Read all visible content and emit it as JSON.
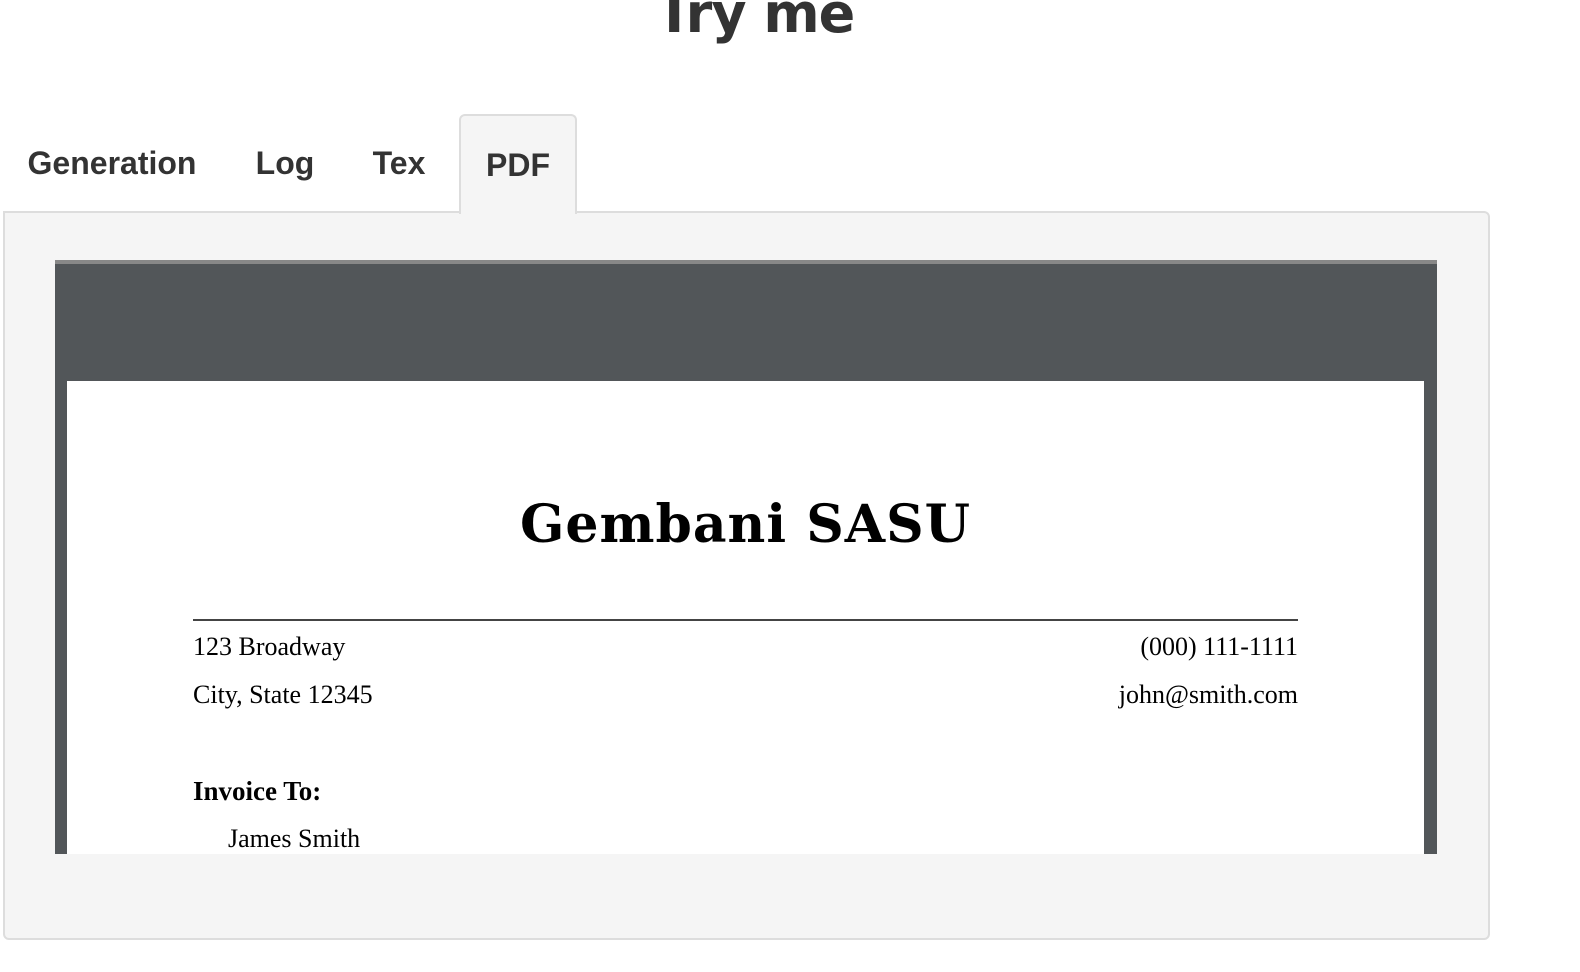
{
  "page": {
    "heading": "Try me"
  },
  "tabs": [
    {
      "label": "Generation",
      "active": false
    },
    {
      "label": "Log",
      "active": false
    },
    {
      "label": "Tex",
      "active": false
    },
    {
      "label": "PDF",
      "active": true
    }
  ],
  "pdf": {
    "company_name": "Gembani SASU",
    "address_line_1": "123 Broadway",
    "address_line_2": "City, State 12345",
    "phone": "(000) 111-1111",
    "email": "john@smith.com",
    "invoice_to_label": "Invoice To:",
    "client_name": "James Smith"
  },
  "colors": {
    "panel_background": "#f5f5f5",
    "viewer_toolbar": "#525659",
    "text": "#333333"
  }
}
